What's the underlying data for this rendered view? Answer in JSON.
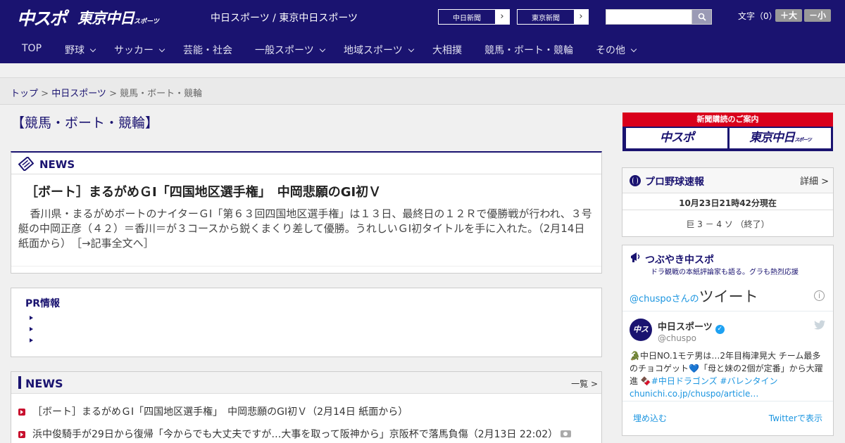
{
  "header": {
    "logo_chuspo": "中スポ",
    "logo_tokyo": "東京中日",
    "logo_tokyo_sub": "スポーツ",
    "site_names": "中日スポーツ / 東京中日スポーツ",
    "ext_links": [
      {
        "label": "中日新聞",
        "arrow": "›"
      },
      {
        "label": "東京新聞",
        "arrow": "›"
      }
    ],
    "search_placeholder": "",
    "font_size_label": "文字（0）",
    "font_plus": "＋大",
    "font_minus": "－小"
  },
  "nav": {
    "items": [
      {
        "label": "TOP"
      },
      {
        "label": "野球"
      },
      {
        "label": "サッカー"
      },
      {
        "label": "芸能・社会"
      },
      {
        "label": "一般スポーツ"
      },
      {
        "label": "地域スポーツ"
      },
      {
        "label": "大相撲"
      },
      {
        "label": "競馬・ボート・競輪"
      },
      {
        "label": "その他"
      }
    ]
  },
  "breadcrumb": {
    "top": "トップ",
    "sep1": " > ",
    "chuspo": "中日スポーツ",
    "sep2": " > ",
    "current": "競馬・ボート・競輪"
  },
  "page_title": "【競馬・ボート・競輪】",
  "news": {
    "label": "NEWS",
    "headline": "［ボート］まるがめＧⅠ「四国地区選手権」　中岡悲願のGI初Ｖ",
    "body": "香川県・まるがめボートのナイターＧⅠ「第６３回四国地区選手権」は１３日、最終日の１２Ｒで優勝戦が行われ、３号艇の中岡正彦（４２）＝香川＝が３コースから鋭くまくり差して優勝。うれしいＧⅠ初タイトルを手に入れた。（2月14日 紙面から）　［→記事全文へ］"
  },
  "pr": {
    "title": "PR情報"
  },
  "news_list": {
    "title": "NEWS",
    "more": "一覧 >",
    "items": [
      {
        "text": "［ボート］まるがめＧⅠ「四国地区選手権」　中岡悲願のGI初Ｖ（2月14日 紙面から）"
      },
      {
        "text": "浜中俊騎手が29日から復帰「今からでも大丈夫ですが…大事を取って阪神から」京阪杯で落馬負傷（2月13日 22:02）"
      }
    ]
  },
  "sidebar": {
    "subscription": {
      "title": "新聞購読のご案内",
      "chuspo": "中スポ",
      "tokyo": "東京中日",
      "tokyo_sub": "スポーツ"
    },
    "scores": {
      "title": "プロ野球速報",
      "detail": "詳細 >",
      "time": "10月23日21時42分現在",
      "result": "巨 3 － 4 ソ （終了）"
    },
    "tweets": {
      "title": "つぶやき中スポ",
      "subtitle": "ドラ観戦の本紙評論家も語る。グラも熱烈応援",
      "head_user": "@chuspo",
      "head_san": "さんの",
      "head_tweets": "ツイート",
      "info": "i",
      "name": "中日スポーツ",
      "handle": "@chuspo",
      "avatar": "中スポ",
      "text_1": "🐊中日NO.1モテ男は…2年目梅津晃大 チーム最多のチョコゲット💙「母と妹の2個が定番」から大躍進 🍫",
      "tag_1": "#中日ドラゴンズ",
      "tag_2": "#バレンタイン",
      "link": "chunichi.co.jp/chuspo/article…",
      "embed": "埋め込む",
      "view": "Twitterで表示"
    }
  }
}
